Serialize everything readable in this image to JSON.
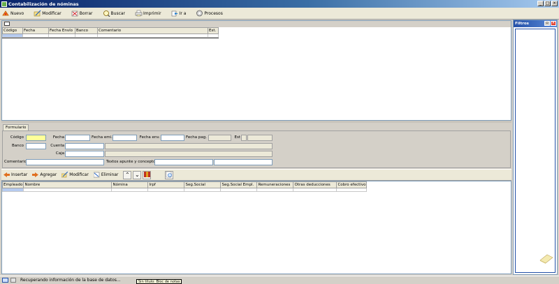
{
  "window": {
    "title": "Contabilización de nóminas",
    "buttons": [
      "_",
      "□",
      "×"
    ]
  },
  "toolbar": {
    "items": [
      {
        "label": "Nuevo",
        "icon": "new-icon"
      },
      {
        "label": "Modificar",
        "icon": "edit-icon"
      },
      {
        "label": "Borrar",
        "icon": "delete-icon"
      },
      {
        "label": "Buscar",
        "icon": "search-icon"
      },
      {
        "label": "Imprimir",
        "icon": "print-icon"
      },
      {
        "label": "Ir a",
        "icon": "goto-icon"
      },
      {
        "label": "Procesos",
        "icon": "process-icon"
      }
    ]
  },
  "top_grid": {
    "columns": [
      "Código",
      "Fecha",
      "Fecha Envío",
      "Banco",
      "Comentario",
      "Est."
    ]
  },
  "form": {
    "tab": "Formulario",
    "labels": {
      "codigo": "Código",
      "fecha": "Fecha",
      "fecha_emi": "Fecha emi.",
      "fecha_env": "Fecha env.",
      "fecha_pag": "Fecha pag.",
      "est": "Est",
      "banco": "Banco",
      "cuenta": "Cuenta",
      "caja": "Caja",
      "comentario": "Comentario",
      "textos": "Textos apunte y concepto"
    }
  },
  "detail_toolbar": {
    "insertar": "Insertar",
    "agregar": "Agregar",
    "modificar": "Modificar",
    "eliminar": "Eliminar"
  },
  "bottom_grid": {
    "columns": [
      "Empleado",
      "Nombre",
      "Nómina",
      "Irpf",
      "Seg.Social",
      "Seg.Social Empl.",
      "Remuneraciones",
      "Otras deducciones",
      "Cobro efectivo"
    ]
  },
  "filtros": {
    "title": "Filtros"
  },
  "status": {
    "text": "Recuperando información de la base de datos..."
  },
  "tooltip": {
    "text": "Sin título: Bloc de notas"
  }
}
